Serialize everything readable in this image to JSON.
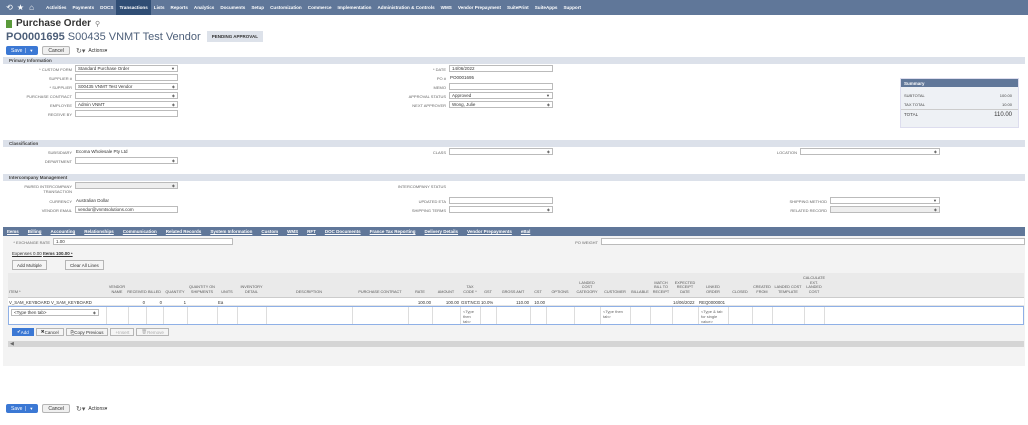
{
  "nav": {
    "items": [
      "Activities",
      "Payments",
      "DOCS",
      "Transactions",
      "Lists",
      "Reports",
      "Analytics",
      "Documents",
      "Setup",
      "Customization",
      "Commerce",
      "Implementation",
      "Administration & Controls",
      "WMS",
      "Vendor Prepayment",
      "SuitePrint",
      "SuiteApps",
      "Support"
    ],
    "active": "Transactions"
  },
  "page": {
    "title": "Purchase Order",
    "record_number": "PO0001695",
    "vendor": "S00435 VNMT Test Vendor",
    "status": "PENDING APPROVAL"
  },
  "buttons": {
    "save": "Save",
    "cancel": "Cancel",
    "actions": "Actions",
    "add_multiple": "Add Multiple",
    "clear_all": "Clear All Lines",
    "add": "Add",
    "inl_cancel": "Cancel",
    "copy_previous": "Copy Previous",
    "insert": "Insert",
    "remove": "Remove"
  },
  "primary": {
    "header": "Primary Information",
    "custom_form_label": "* CUSTOM FORM",
    "custom_form": "Standard Purchase Order",
    "supplier_no_label": "SUPPLIER #",
    "supplier_label": "* SUPPLIER",
    "supplier": "S00435 VNMT Test Vendor",
    "purchase_contract_label": "PURCHASE CONTRACT",
    "employee_label": "EMPLOYEE",
    "employee": "Admin VNMT",
    "receive_by_label": "RECEIVE BY",
    "date_label": "* DATE",
    "date": "14/06/2022",
    "po_label": "PO #",
    "po": "PO0001695",
    "memo_label": "MEMO",
    "approval_status_label": "APPROVAL STATUS",
    "approval_status": "Approved",
    "next_approver_label": "NEXT APPROVER",
    "next_approver": "Wong, Julie"
  },
  "summary": {
    "header": "Summary",
    "subtotal_label": "SUBTOTAL",
    "subtotal": "100.00",
    "taxtotal_label": "TAX TOTAL",
    "taxtotal": "10.00",
    "total_label": "TOTAL",
    "total": "110.00"
  },
  "classification": {
    "header": "Classification",
    "subsidiary_label": "SUBSIDIARY",
    "subsidiary": "Ecoma Wholesale Pty Ltd",
    "department_label": "DEPARTMENT",
    "class_label": "CLASS",
    "location_label": "LOCATION"
  },
  "intercompany": {
    "header": "Intercompany Management",
    "paired_label_1": "PAIRED INTERCOMPANY",
    "paired_label_2": "TRANSACTION",
    "ic_status_label": "INTERCOMPANY STATUS",
    "currency_label": "CURRENCY",
    "currency": "Australian Dollar",
    "vendor_email_label": "VENDOR EMAIL",
    "vendor_email": "vendor@vnmtsolutions.com",
    "updated_eta_label": "UPDATED ETA",
    "shipping_terms_label": "SHIPPING TERMS",
    "shipping_method_label": "SHIPPING METHOD",
    "related_record_label": "RELATED RECORD"
  },
  "subtabs": [
    "Items",
    "Billing",
    "Accounting",
    "Relationships",
    "Communication",
    "Related Records",
    "System Information",
    "Custom",
    "WMS",
    "RFT",
    "DOC Documents",
    "France Tax Reporting",
    "Delivery Details",
    "Vendor Prepayments",
    "eBal"
  ],
  "items_tab": {
    "exchange_rate_label": "* EXCHANGE RATE",
    "exchange_rate": "1.00",
    "po_weight_label": "PO WEIGHT",
    "expenses_tab": "Expenses 0.00",
    "items_tab": "Items 100.00 •"
  },
  "grid": {
    "columns": [
      "ITEM *",
      "VENDOR NAME",
      "RECEIVED",
      "BILLED",
      "QUANTITY",
      "QUANTITY ON SHIPMENTS",
      "UNITS",
      "INVENTORY DETAIL",
      "DESCRIPTION",
      "PURCHASE CONTRACT",
      "RATE",
      "AMOUNT",
      "TAX CODE *",
      "GST",
      "GROSS AMT",
      "CST",
      "OPTIONS",
      "LANDED COST CATEGORY",
      "CUSTOMER",
      "BILLABLE",
      "MATCH BILL TO RECEIPT",
      "EXPECTED RECEIPT DATE",
      "LINKED ORDER",
      "CLOSED",
      "CREATED FROM",
      "LANDED COST TEMPLATE",
      "CALCULATE EXT. LANDED COST"
    ],
    "rows": [
      [
        "V_SAM_KEYBOARD V_SAM_KEYBOARD",
        "",
        "0",
        "0",
        "1",
        "",
        "Ea",
        "",
        "",
        "",
        "100.00",
        "100.00",
        "GST:NCG-AU",
        "10.0%",
        "110.00",
        "10.00",
        "",
        "",
        "",
        "",
        "",
        "14/06/2022",
        "REQ0000001",
        "",
        "",
        "",
        ""
      ]
    ],
    "entry": {
      "item_placeholder": "<Type then tab>",
      "tax_placeholder": "<Type then tab>",
      "customer_placeholder": "<Type then tab>",
      "linked_placeholder": "<Type & tab for single value>"
    }
  }
}
